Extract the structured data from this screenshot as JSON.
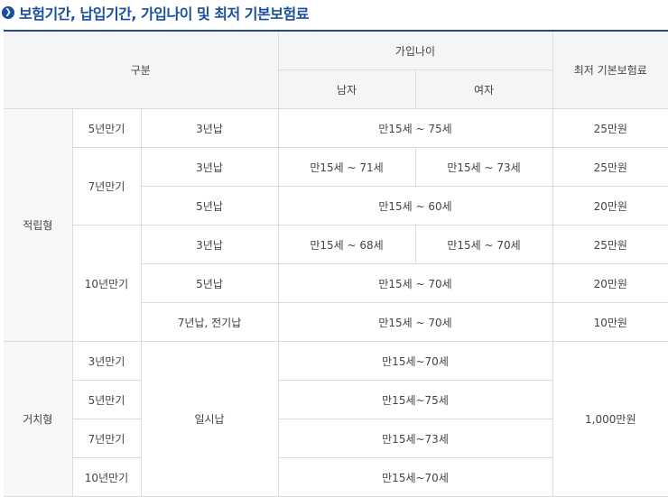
{
  "title": "보험기간, 납입기간, 가입나이 및 최저 기본보험료",
  "icons": {
    "title_bullet": "chevron-right-circle-icon"
  },
  "colors": {
    "accent": "#1a4f9c",
    "header_bg": "#f4f5f7",
    "border": "#dcdcdc"
  },
  "header": {
    "category": "구분",
    "age_group": "가입나이",
    "male": "남자",
    "female": "여자",
    "min_premium": "최저 기본보험료"
  },
  "accumulation": {
    "type": "적립형",
    "r5": {
      "term": "5년만기",
      "pay": "3년납",
      "age": "만15세 ~ 75세",
      "premium": "25만원"
    },
    "r7": {
      "term": "7년만기",
      "a": {
        "pay": "3년납",
        "male": "만15세 ~ 71세",
        "female": "만15세 ~ 73세",
        "premium": "25만원"
      },
      "b": {
        "pay": "5년납",
        "age": "만15세 ~ 60세",
        "premium": "20만원"
      }
    },
    "r10": {
      "term": "10년만기",
      "a": {
        "pay": "3년납",
        "male": "만15세 ~ 68세",
        "female": "만15세 ~ 70세",
        "premium": "25만원"
      },
      "b": {
        "pay": "5년납",
        "age": "만15세 ~ 70세",
        "premium": "20만원"
      },
      "c": {
        "pay": "7년납, 전기납",
        "age": "만15세 ~ 70세",
        "premium": "10만원"
      }
    }
  },
  "deferred": {
    "type": "거치형",
    "pay": "일시납",
    "premium": "1,000만원",
    "rows": [
      {
        "term": "3년만기",
        "age": "만15세~70세"
      },
      {
        "term": "5년만기",
        "age": "만15세~75세"
      },
      {
        "term": "7년만기",
        "age": "만15세~73세"
      },
      {
        "term": "10년만기",
        "age": "만15세~70세"
      }
    ]
  }
}
